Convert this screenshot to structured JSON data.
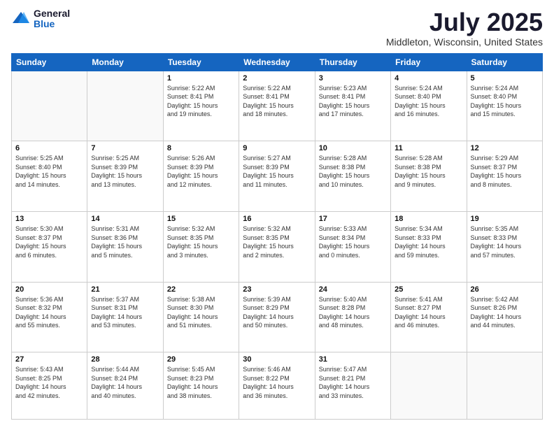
{
  "logo": {
    "general": "General",
    "blue": "Blue"
  },
  "header": {
    "title": "July 2025",
    "subtitle": "Middleton, Wisconsin, United States"
  },
  "weekdays": [
    "Sunday",
    "Monday",
    "Tuesday",
    "Wednesday",
    "Thursday",
    "Friday",
    "Saturday"
  ],
  "weeks": [
    [
      {
        "day": "",
        "info": ""
      },
      {
        "day": "",
        "info": ""
      },
      {
        "day": "1",
        "info": "Sunrise: 5:22 AM\nSunset: 8:41 PM\nDaylight: 15 hours\nand 19 minutes."
      },
      {
        "day": "2",
        "info": "Sunrise: 5:22 AM\nSunset: 8:41 PM\nDaylight: 15 hours\nand 18 minutes."
      },
      {
        "day": "3",
        "info": "Sunrise: 5:23 AM\nSunset: 8:41 PM\nDaylight: 15 hours\nand 17 minutes."
      },
      {
        "day": "4",
        "info": "Sunrise: 5:24 AM\nSunset: 8:40 PM\nDaylight: 15 hours\nand 16 minutes."
      },
      {
        "day": "5",
        "info": "Sunrise: 5:24 AM\nSunset: 8:40 PM\nDaylight: 15 hours\nand 15 minutes."
      }
    ],
    [
      {
        "day": "6",
        "info": "Sunrise: 5:25 AM\nSunset: 8:40 PM\nDaylight: 15 hours\nand 14 minutes."
      },
      {
        "day": "7",
        "info": "Sunrise: 5:25 AM\nSunset: 8:39 PM\nDaylight: 15 hours\nand 13 minutes."
      },
      {
        "day": "8",
        "info": "Sunrise: 5:26 AM\nSunset: 8:39 PM\nDaylight: 15 hours\nand 12 minutes."
      },
      {
        "day": "9",
        "info": "Sunrise: 5:27 AM\nSunset: 8:39 PM\nDaylight: 15 hours\nand 11 minutes."
      },
      {
        "day": "10",
        "info": "Sunrise: 5:28 AM\nSunset: 8:38 PM\nDaylight: 15 hours\nand 10 minutes."
      },
      {
        "day": "11",
        "info": "Sunrise: 5:28 AM\nSunset: 8:38 PM\nDaylight: 15 hours\nand 9 minutes."
      },
      {
        "day": "12",
        "info": "Sunrise: 5:29 AM\nSunset: 8:37 PM\nDaylight: 15 hours\nand 8 minutes."
      }
    ],
    [
      {
        "day": "13",
        "info": "Sunrise: 5:30 AM\nSunset: 8:37 PM\nDaylight: 15 hours\nand 6 minutes."
      },
      {
        "day": "14",
        "info": "Sunrise: 5:31 AM\nSunset: 8:36 PM\nDaylight: 15 hours\nand 5 minutes."
      },
      {
        "day": "15",
        "info": "Sunrise: 5:32 AM\nSunset: 8:35 PM\nDaylight: 15 hours\nand 3 minutes."
      },
      {
        "day": "16",
        "info": "Sunrise: 5:32 AM\nSunset: 8:35 PM\nDaylight: 15 hours\nand 2 minutes."
      },
      {
        "day": "17",
        "info": "Sunrise: 5:33 AM\nSunset: 8:34 PM\nDaylight: 15 hours\nand 0 minutes."
      },
      {
        "day": "18",
        "info": "Sunrise: 5:34 AM\nSunset: 8:33 PM\nDaylight: 14 hours\nand 59 minutes."
      },
      {
        "day": "19",
        "info": "Sunrise: 5:35 AM\nSunset: 8:33 PM\nDaylight: 14 hours\nand 57 minutes."
      }
    ],
    [
      {
        "day": "20",
        "info": "Sunrise: 5:36 AM\nSunset: 8:32 PM\nDaylight: 14 hours\nand 55 minutes."
      },
      {
        "day": "21",
        "info": "Sunrise: 5:37 AM\nSunset: 8:31 PM\nDaylight: 14 hours\nand 53 minutes."
      },
      {
        "day": "22",
        "info": "Sunrise: 5:38 AM\nSunset: 8:30 PM\nDaylight: 14 hours\nand 51 minutes."
      },
      {
        "day": "23",
        "info": "Sunrise: 5:39 AM\nSunset: 8:29 PM\nDaylight: 14 hours\nand 50 minutes."
      },
      {
        "day": "24",
        "info": "Sunrise: 5:40 AM\nSunset: 8:28 PM\nDaylight: 14 hours\nand 48 minutes."
      },
      {
        "day": "25",
        "info": "Sunrise: 5:41 AM\nSunset: 8:27 PM\nDaylight: 14 hours\nand 46 minutes."
      },
      {
        "day": "26",
        "info": "Sunrise: 5:42 AM\nSunset: 8:26 PM\nDaylight: 14 hours\nand 44 minutes."
      }
    ],
    [
      {
        "day": "27",
        "info": "Sunrise: 5:43 AM\nSunset: 8:25 PM\nDaylight: 14 hours\nand 42 minutes."
      },
      {
        "day": "28",
        "info": "Sunrise: 5:44 AM\nSunset: 8:24 PM\nDaylight: 14 hours\nand 40 minutes."
      },
      {
        "day": "29",
        "info": "Sunrise: 5:45 AM\nSunset: 8:23 PM\nDaylight: 14 hours\nand 38 minutes."
      },
      {
        "day": "30",
        "info": "Sunrise: 5:46 AM\nSunset: 8:22 PM\nDaylight: 14 hours\nand 36 minutes."
      },
      {
        "day": "31",
        "info": "Sunrise: 5:47 AM\nSunset: 8:21 PM\nDaylight: 14 hours\nand 33 minutes."
      },
      {
        "day": "",
        "info": ""
      },
      {
        "day": "",
        "info": ""
      }
    ]
  ]
}
